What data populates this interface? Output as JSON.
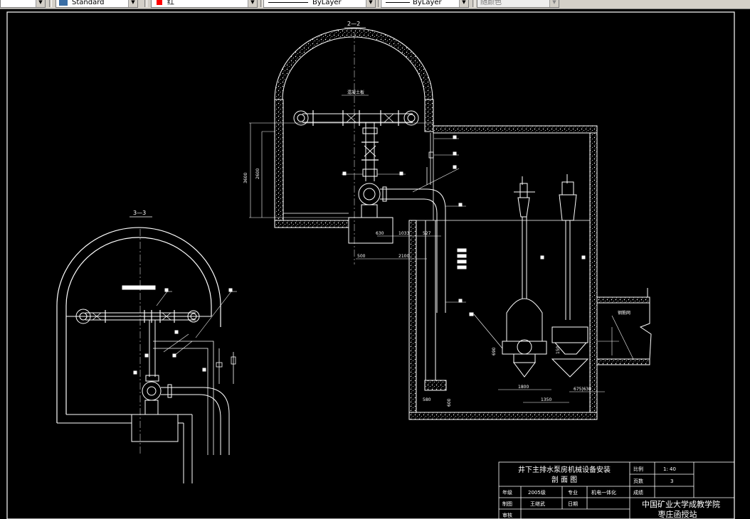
{
  "toolbar": {
    "text_style": "Standard",
    "color": "红",
    "color_swatch": "#ff0000",
    "linetype": "ByLayer",
    "lineweight": "ByLayer",
    "plot_style": "随颜色"
  },
  "drawing": {
    "section_22_label": "2—2",
    "section_33_label": "3—3",
    "slab_label": "混凝土板",
    "wall_label": "钢筋网",
    "dim_3600": "3600",
    "dim_2600": "2600",
    "dim_630": "630",
    "dim_1033": "1033",
    "dim_527": "527",
    "dim_500": "500",
    "dim_2100": "2100",
    "dim_1800": "1800",
    "dim_1350": "1350",
    "dim_675": "675|630",
    "dim_600": "600",
    "dim_580": "580",
    "dim_690": "690",
    "dim_150": "150"
  },
  "title_block": {
    "title_line1": "井下主排水泵房机械设备安装",
    "title_line2": "剖 面 图",
    "scale_label": "比例",
    "scale_value": "1: 40",
    "pages_label": "页数",
    "pages_value": "3",
    "grade_label": "年级",
    "grade_value": "2005级",
    "major_label": "专业",
    "major_value": "机电一体化",
    "score_label": "成绩",
    "drawn_label": "制图",
    "drawn_value": "王继武",
    "date_label": "日期",
    "check_label": "审核",
    "school_line1": "中国矿业大学成教学院",
    "school_line2": "枣庄函授站"
  }
}
